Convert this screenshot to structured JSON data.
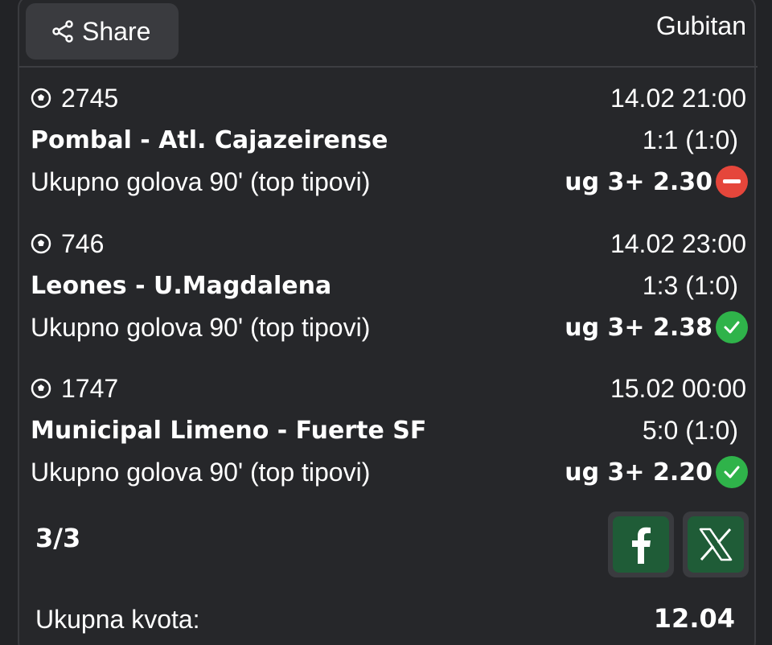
{
  "header": {
    "share_label": "Share",
    "status": "Gubitan"
  },
  "matches": [
    {
      "id": "2745",
      "datetime": "14.02 21:00",
      "teams": "Pombal - Atl. Cajazeirense",
      "score": "1:1 (1:0)",
      "market": "Ukupno golova 90' (top tipovi)",
      "pick": "ug 3+ 2.30",
      "result": "lost"
    },
    {
      "id": "746",
      "datetime": "14.02 23:00",
      "teams": "Leones - U.Magdalena",
      "score": "1:3 (1:0)",
      "market": "Ukupno golova 90' (top tipovi)",
      "pick": "ug 3+ 2.38",
      "result": "won"
    },
    {
      "id": "1747",
      "datetime": "15.02 00:00",
      "teams": "Municipal Limeno - Fuerte SF",
      "score": "5:0 (1:0)",
      "market": "Ukupno golova 90' (top tipovi)",
      "pick": "ug 3+ 2.20",
      "result": "won"
    }
  ],
  "summary": {
    "count": "3/3",
    "total_label": "Ukupna kvota:",
    "total_value": "12.04"
  },
  "icons": {
    "sport": "soccer-ball-icon",
    "lost": "minus-circle-icon",
    "won": "check-circle-icon",
    "facebook": "facebook-icon",
    "x": "x-icon"
  },
  "colors": {
    "background": "#222326",
    "lost": "#e5463b",
    "won": "#2fb34a",
    "social_bg": "#1f5c37"
  }
}
